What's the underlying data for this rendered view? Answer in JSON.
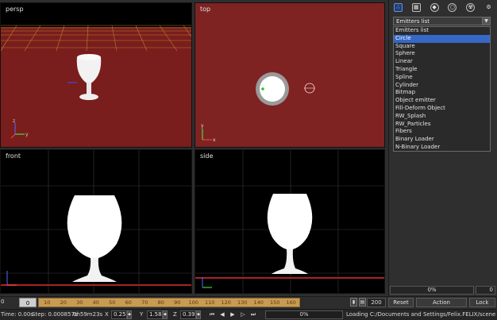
{
  "viewports": {
    "persp": "persp",
    "top": "top",
    "front": "front",
    "side": "side"
  },
  "axes": {
    "y": "y",
    "z": "z",
    "x": "x"
  },
  "panel": {
    "tool_icons": [
      "particle-icon",
      "grid-icon",
      "shield-icon",
      "circle-icon",
      "radiation-icon",
      "gear-icon"
    ],
    "dropdown_value": "Emitters list",
    "list_items": [
      "Emitters list",
      "Circle",
      "Square",
      "Sphere",
      "Linear",
      "Triangle",
      "Spline",
      "Cylinder",
      "Bitmap",
      "Object emitter",
      "Fill-Deform Object",
      "RW_Splash",
      "RW_Particles",
      "Fibers",
      "Binary Loader",
      "N-Binary Loader"
    ],
    "selected_index": 1,
    "progress_label": "0%",
    "count_value": "0"
  },
  "timeline": {
    "start": "0",
    "current_frame": "0",
    "ticks": [
      "10",
      "20",
      "30",
      "40",
      "50",
      "60",
      "70",
      "80",
      "90",
      "100",
      "110",
      "120",
      "130",
      "140",
      "150",
      "160"
    ],
    "end": "200",
    "reset_label": "Reset",
    "action_label": "Action",
    "lock_label": "Lock"
  },
  "statusbar": {
    "time": "Time: 0.00s",
    "step": "Step: 0.000857s",
    "elapsed": "0h59m23s",
    "x_label": "X",
    "x_value": "0.25",
    "y_label": "Y",
    "y_value": "1.58",
    "z_label": "Z",
    "z_value": "0.39",
    "progress": "0%",
    "message": "Loading C:/Documents and Settings/Felix.FELIX/scenes/..."
  },
  "colors": {
    "viewport_red": "#7a1d1d",
    "selection_blue": "#3568c7",
    "timeline_orange": "#c89a52"
  }
}
